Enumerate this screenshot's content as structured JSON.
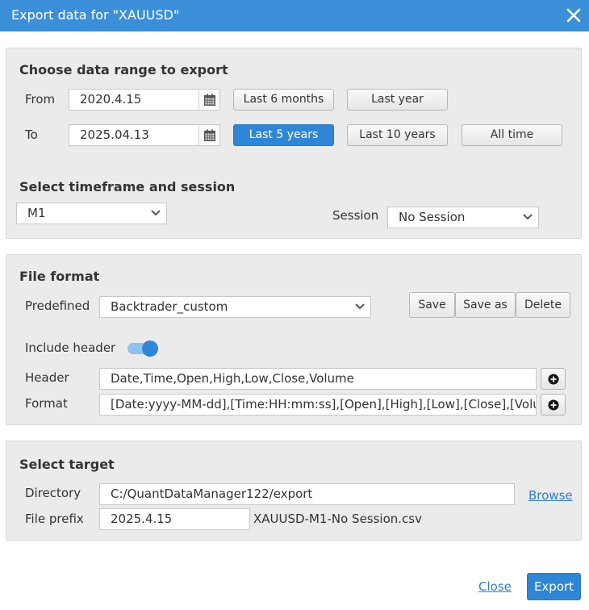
{
  "dialog": {
    "title": "Export data for \"XAUUSD\"",
    "close_icon": "close-icon"
  },
  "range": {
    "heading": "Choose data range to export",
    "from_label": "From",
    "from_value": "2020.4.15",
    "to_label": "To",
    "to_value": "2025.04.13",
    "presets": {
      "last_6_months": "Last 6 months",
      "last_year": "Last year",
      "last_5_years": "Last 5 years",
      "last_10_years": "Last 10 years",
      "all_time": "All time"
    },
    "active_preset": "last_5_years",
    "calendar_icon": "calendar-icon"
  },
  "timeframe": {
    "heading": "Select timeframe and session",
    "timeframe_value": "M1",
    "session_label": "Session",
    "session_value": "No Session"
  },
  "file_format": {
    "heading": "File format",
    "predefined_label": "Predefined",
    "predefined_value": "Backtrader_custom",
    "save_label": "Save",
    "save_as_label": "Save as",
    "delete_label": "Delete",
    "include_header_label": "Include header",
    "include_header_on": true,
    "header_label": "Header",
    "header_value": "Date,Time,Open,High,Low,Close,Volume",
    "format_label": "Format",
    "format_value": "[Date:yyyy-MM-dd],[Time:HH:mm:ss],[Open],[High],[Low],[Close],[Volume]",
    "add_icon": "plus-circle-icon"
  },
  "target": {
    "heading": "Select target",
    "directory_label": "Directory",
    "directory_value": "C:/QuantDataManager122/export",
    "browse_label": "Browse",
    "prefix_label": "File prefix",
    "prefix_value": "2025.4.15",
    "filename_preview": "XAUUSD-M1-No Session.csv"
  },
  "footer": {
    "close_label": "Close",
    "export_label": "Export"
  },
  "colors": {
    "accent": "#2f86d6",
    "titlebar": "#3b8fd9",
    "panel": "#ebebeb",
    "link": "#2f7ccb"
  }
}
